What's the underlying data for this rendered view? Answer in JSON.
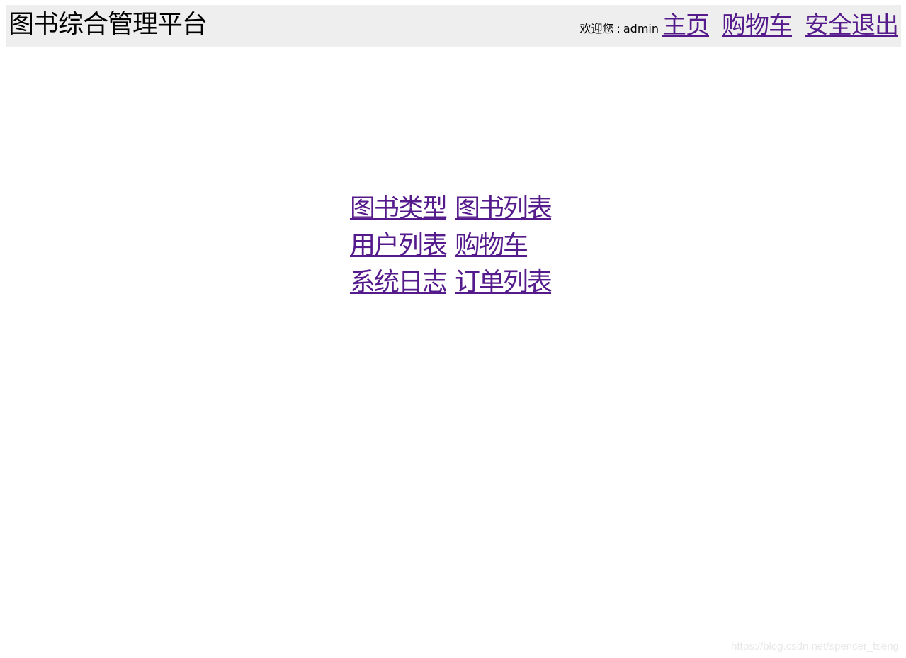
{
  "header": {
    "title": "图书综合管理平台",
    "welcome_prefix": "欢迎您",
    "separator": ":",
    "username": "admin",
    "nav": [
      {
        "label": "主页"
      },
      {
        "label": "购物车"
      },
      {
        "label": "安全退出"
      }
    ]
  },
  "menu": {
    "items": [
      {
        "label": "图书类型"
      },
      {
        "label": "图书列表"
      },
      {
        "label": "用户列表"
      },
      {
        "label": "购物车"
      },
      {
        "label": "系统日志"
      },
      {
        "label": "订单列表"
      }
    ]
  },
  "watermark": "https://blog.csdn.net/spencer_tseng",
  "colors": {
    "header_bg": "#eeeeee",
    "link": "#551a8b",
    "text": "#000000"
  }
}
